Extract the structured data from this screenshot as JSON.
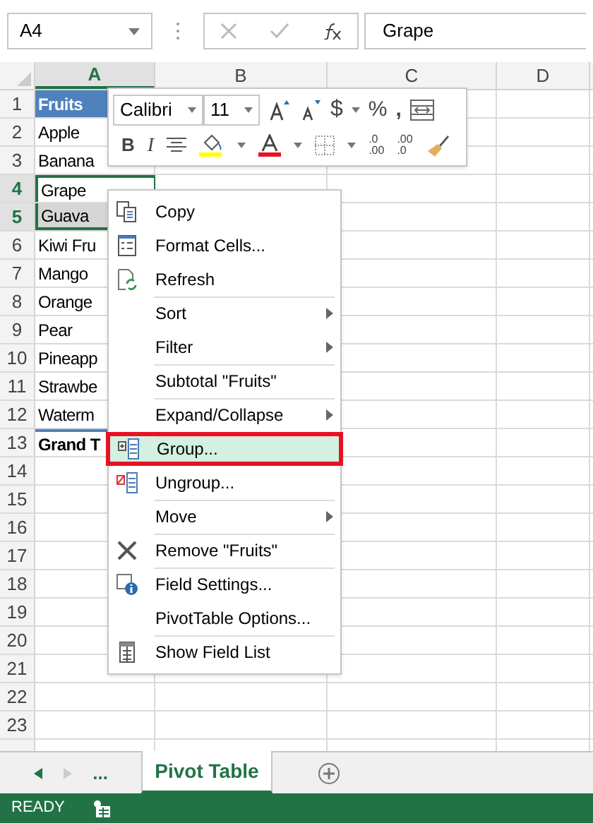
{
  "name_box": "A4",
  "formula_value": "Grape",
  "columns": [
    {
      "label": "A",
      "selected": true
    },
    {
      "label": "B",
      "selected": false
    },
    {
      "label": "C",
      "selected": false
    },
    {
      "label": "D",
      "selected": false
    }
  ],
  "rows": [
    {
      "label": "1",
      "selected": false,
      "kind": "header",
      "a": "Fruits"
    },
    {
      "label": "2",
      "selected": false,
      "kind": "item",
      "a": "Apple"
    },
    {
      "label": "3",
      "selected": false,
      "kind": "item",
      "a": "Banana"
    },
    {
      "label": "4",
      "selected": true,
      "kind": "item",
      "a": "Grape"
    },
    {
      "label": "5",
      "selected": true,
      "kind": "item",
      "a": "Guava"
    },
    {
      "label": "6",
      "selected": false,
      "kind": "item",
      "a": "Kiwi Fru"
    },
    {
      "label": "7",
      "selected": false,
      "kind": "item",
      "a": "Mango"
    },
    {
      "label": "8",
      "selected": false,
      "kind": "item",
      "a": "Orange"
    },
    {
      "label": "9",
      "selected": false,
      "kind": "item",
      "a": "Pear"
    },
    {
      "label": "10",
      "selected": false,
      "kind": "item",
      "a": "Pineapp"
    },
    {
      "label": "11",
      "selected": false,
      "kind": "item",
      "a": "Strawbe"
    },
    {
      "label": "12",
      "selected": false,
      "kind": "item",
      "a": "Waterm"
    },
    {
      "label": "13",
      "selected": false,
      "kind": "total",
      "a": "Grand T"
    },
    {
      "label": "14",
      "selected": false,
      "kind": "item"
    },
    {
      "label": "15",
      "selected": false,
      "kind": "item"
    },
    {
      "label": "16",
      "selected": false,
      "kind": "item"
    },
    {
      "label": "17",
      "selected": false,
      "kind": "item"
    },
    {
      "label": "18",
      "selected": false,
      "kind": "item"
    },
    {
      "label": "19",
      "selected": false,
      "kind": "item"
    },
    {
      "label": "20",
      "selected": false,
      "kind": "item"
    },
    {
      "label": "21",
      "selected": false,
      "kind": "item"
    },
    {
      "label": "22",
      "selected": false,
      "kind": "item"
    },
    {
      "label": "23",
      "selected": false,
      "kind": "item"
    }
  ],
  "mini_toolbar": {
    "font": "Calibri",
    "size": "11",
    "currency": "$",
    "percent": "%",
    "comma": ",",
    "bold": "B",
    "italic": "I",
    "increase_decimal": ".0\n.00",
    "decrease_decimal": ".00\n.0"
  },
  "context_menu": [
    {
      "label": "Copy",
      "selected": false,
      "submenu": false,
      "divider_before": false
    },
    {
      "label": "Format Cells...",
      "selected": false,
      "submenu": false,
      "divider_before": false
    },
    {
      "label": "Refresh",
      "selected": false,
      "submenu": false,
      "divider_before": false
    },
    {
      "label": "Sort",
      "selected": false,
      "submenu": true,
      "divider_before": true
    },
    {
      "label": "Filter",
      "selected": false,
      "submenu": true,
      "divider_before": false
    },
    {
      "label": "Subtotal \"Fruits\"",
      "selected": false,
      "submenu": false,
      "divider_before": true
    },
    {
      "label": "Expand/Collapse",
      "selected": false,
      "submenu": true,
      "divider_before": true
    },
    {
      "label": "Group...",
      "selected": true,
      "submenu": false,
      "divider_before": true
    },
    {
      "label": "Ungroup...",
      "selected": false,
      "submenu": false,
      "divider_before": false
    },
    {
      "label": "Move",
      "selected": false,
      "submenu": true,
      "divider_before": true
    },
    {
      "label": "Remove \"Fruits\"",
      "selected": false,
      "submenu": false,
      "divider_before": true
    },
    {
      "label": "Field Settings...",
      "selected": false,
      "submenu": false,
      "divider_before": true
    },
    {
      "label": "PivotTable Options...",
      "selected": false,
      "submenu": false,
      "divider_before": false
    },
    {
      "label": "Show Field List",
      "selected": false,
      "submenu": false,
      "divider_before": true
    }
  ],
  "sheet_tabs": {
    "ellipsis": "...",
    "tabs": [
      {
        "label": "Pivot Table",
        "selected": true
      }
    ]
  },
  "status": "READY"
}
